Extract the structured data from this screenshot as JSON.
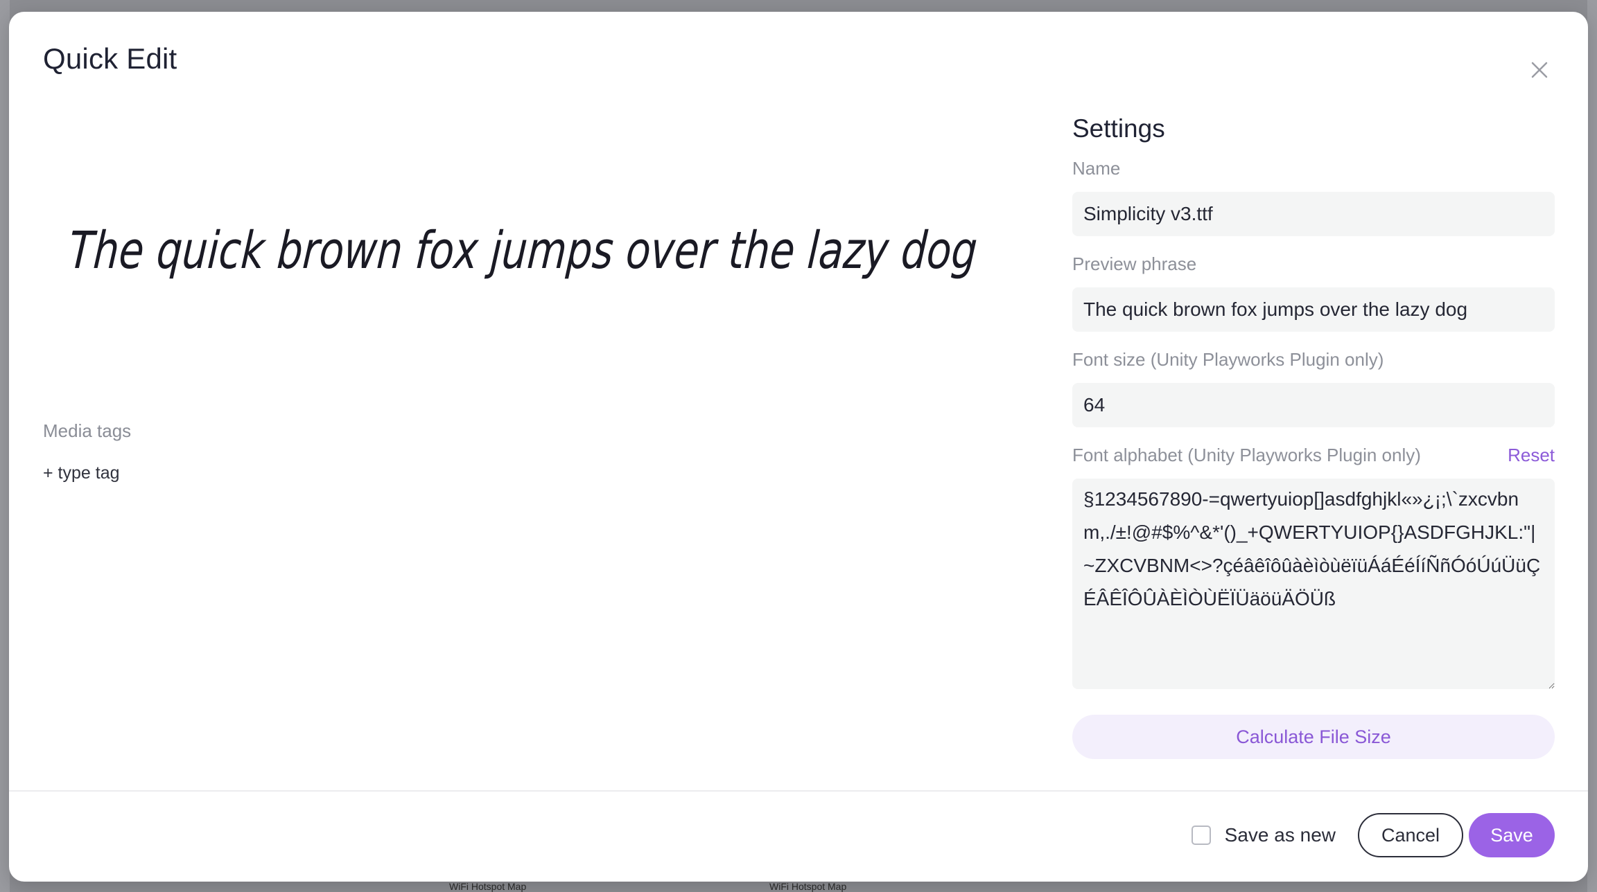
{
  "modal": {
    "title": "Quick Edit"
  },
  "preview": {
    "phrase": "The quick brown fox jumps over the lazy dog"
  },
  "media_tags": {
    "label": "Media tags",
    "add_placeholder": "+ type tag"
  },
  "settings": {
    "title": "Settings",
    "name_label": "Name",
    "name_value": "Simplicity v3.ttf",
    "phrase_label": "Preview phrase",
    "phrase_value": "The quick brown fox jumps over the lazy dog",
    "font_size_label": "Font size (Unity Playworks Plugin only)",
    "font_size_value": "64",
    "alphabet_label": "Font alphabet (Unity Playworks Plugin only)",
    "alphabet_reset": "Reset",
    "alphabet_value": "§1234567890-=qwertyuiop[]asdfghjkl«»¿¡;\\`zxcvbnm,./±!@#$%^&*'()_+QWERTYUIOP{}ASDFGHJKL:\"|~ZXCVBNM<>?çéâêîôûàèìòùëïüÁáÉéÍíÑñÓóÚúÜüÇÉÂÊÎÔÛÀÈÌÒÙËÏÜäöüÄÖÜß",
    "calc_button": "Calculate File Size"
  },
  "footer": {
    "save_as_new_label": "Save as new",
    "save_as_new_checked": false,
    "cancel_label": "Cancel",
    "save_label": "Save"
  },
  "background": {
    "label_1": "WiFi Hotspot Map",
    "label_2": "WiFi Hotspot Map"
  },
  "colors": {
    "accent": "#9b63e6",
    "accent_text": "#8a58d6",
    "accent_soft": "#f3effc",
    "text_primary": "#1f2233",
    "text_muted": "#8d9099",
    "input_bg": "#f4f5f5"
  }
}
